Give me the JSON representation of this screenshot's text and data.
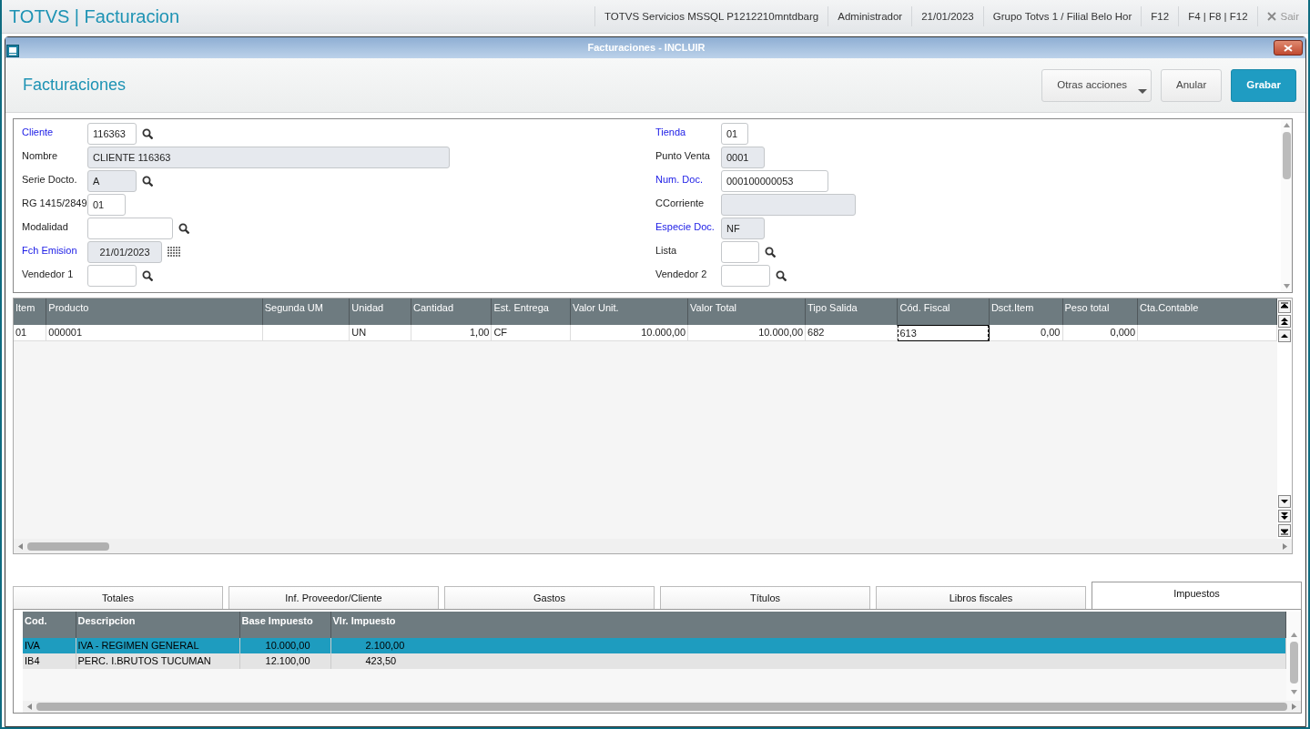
{
  "app_bar": {
    "title": "TOTVS | Facturacion",
    "items": [
      "TOTVS Servicios MSSQL P1212210mntdbarg",
      "Administrador",
      "21/01/2023",
      "Grupo Totvs 1 / Filial Belo Hor",
      "F12",
      "F4 | F8 | F12"
    ],
    "exit": "Sair"
  },
  "window": {
    "title": "Facturaciones - INCLUIR"
  },
  "header": {
    "title": "Facturaciones",
    "buttons": [
      {
        "label": "Otras acciones",
        "kind": "menu"
      },
      {
        "label": "Anular",
        "kind": "plain"
      },
      {
        "label": "Grabar",
        "kind": "primary"
      }
    ]
  },
  "form": {
    "left": [
      {
        "label": "Cliente",
        "value": "116363",
        "required": true,
        "disabled": false,
        "kind": "search"
      },
      {
        "label": "Nombre",
        "value": "CLIENTE 116363",
        "required": false,
        "disabled": true,
        "kind": "plain"
      },
      {
        "label": "Serie Docto.",
        "value": "A",
        "required": false,
        "disabled": true,
        "kind": "search"
      },
      {
        "label": "RG 1415/2849",
        "value": "01",
        "required": false,
        "disabled": false,
        "kind": "plain"
      },
      {
        "label": "Modalidad",
        "required": false,
        "disabled": false,
        "kind": "search"
      },
      {
        "label": "Fch Emision",
        "value": "21/01/2023",
        "required": true,
        "disabled": true,
        "kind": "calendar"
      },
      {
        "label": "Vendedor 1",
        "required": false,
        "disabled": false,
        "kind": "search"
      }
    ],
    "right": [
      {
        "label": "Tienda",
        "value": "01",
        "required": true,
        "disabled": false,
        "kind": "plain"
      },
      {
        "label": "Punto Venta",
        "value": "0001",
        "required": false,
        "disabled": true,
        "kind": "plain"
      },
      {
        "label": "Num. Doc.",
        "value": "000100000053",
        "required": true,
        "disabled": false,
        "kind": "plain"
      },
      {
        "label": "CCorriente",
        "required": false,
        "disabled": true,
        "kind": "plain"
      },
      {
        "label": "Especie Doc.",
        "value": "NF",
        "required": true,
        "disabled": true,
        "kind": "plain"
      },
      {
        "label": "Lista",
        "required": false,
        "disabled": false,
        "kind": "search"
      },
      {
        "label": "Vendedor 2",
        "required": false,
        "disabled": false,
        "kind": "search"
      }
    ]
  },
  "items_table": {
    "columns": [
      "Item",
      "Producto",
      "Segunda UM",
      "Unidad",
      "Cantidad",
      "Est. Entrega",
      "Valor Unit.",
      "Valor Total",
      "Tipo Salida",
      "Cód. Fiscal",
      "Dsct.Item",
      "Peso total",
      "Cta.Contable"
    ],
    "rows": [
      {
        "cells": [
          {
            "text": "01",
            "focused": false
          },
          {
            "text": "000001",
            "focused": false
          },
          {
            "focused": false
          },
          {
            "text": "UN",
            "focused": false
          },
          {
            "text": "1,00",
            "focused": false
          },
          {
            "text": "CF",
            "focused": false
          },
          {
            "text": "10.000,00",
            "focused": false
          },
          {
            "text": "10.000,00",
            "focused": false
          },
          {
            "text": "682",
            "focused": false
          },
          {
            "text": "613",
            "focused": true
          },
          {
            "text": "0,00",
            "focused": false
          },
          {
            "text": "0,000",
            "focused": false
          },
          {
            "focused": false
          }
        ]
      }
    ]
  },
  "tabs": [
    {
      "label": "Totales",
      "selected": false
    },
    {
      "label": "Inf. Proveedor/Cliente",
      "selected": false
    },
    {
      "label": "Gastos",
      "selected": false
    },
    {
      "label": "Títulos",
      "selected": false
    },
    {
      "label": "Libros fiscales",
      "selected": false
    },
    {
      "label": "Impuestos",
      "selected": true
    }
  ],
  "tax_table": {
    "columns": [
      "Cod.",
      "Descripcion",
      "Base Impuesto",
      "Vlr. Impuesto"
    ],
    "rows": [
      {
        "cells": [
          "IVA",
          "IVA - REGIMEN GENERAL",
          "10.000,00",
          "2.100,00"
        ],
        "selected": true
      },
      {
        "cells": [
          "IB4",
          "PERC. I.BRUTOS TUCUMAN",
          "12.100,00",
          "423,50"
        ],
        "selected": false
      }
    ]
  }
}
